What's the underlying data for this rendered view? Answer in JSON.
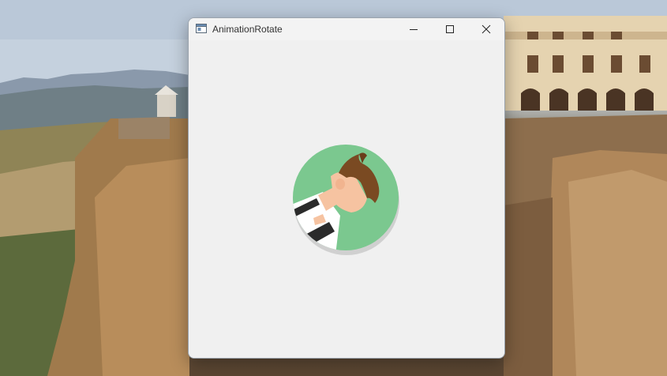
{
  "window": {
    "title": "AnimationRotate",
    "controls": {
      "minimize_icon": "minimize-icon",
      "maximize_icon": "maximize-icon",
      "close_icon": "close-icon"
    }
  },
  "content": {
    "image": "rotated-avatar-illustration",
    "colors": {
      "circle": "#7bc88f",
      "hair": "#7a4a22",
      "skin": "#f6c3a1",
      "shirt": "#ffffff",
      "stripes": "#2b2b2b"
    }
  }
}
